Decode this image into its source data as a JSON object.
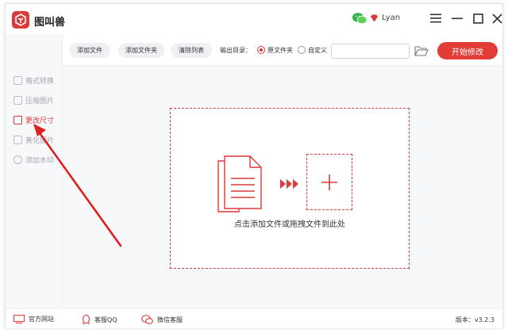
{
  "app": {
    "title": "图叫兽"
  },
  "user": {
    "name": "Lyan"
  },
  "sidebar": {
    "items": [
      {
        "label": "格式转换",
        "active": false
      },
      {
        "label": "压缩图片",
        "active": false
      },
      {
        "label": "更改尺寸",
        "active": true
      },
      {
        "label": "美化图片",
        "active": false
      },
      {
        "label": "添加水印",
        "active": false
      }
    ]
  },
  "toolbar": {
    "add_file": "添加文件",
    "add_folder": "添加文件夹",
    "clear_list": "清除列表",
    "output_label": "输出目录：",
    "option_original": "原文件夹",
    "option_custom": "自定义",
    "path_value": "",
    "start": "开始修改"
  },
  "dropzone": {
    "hint": "点击添加文件或拖拽文件到此处"
  },
  "footer": {
    "website": "官方网站",
    "qq": "客服QQ",
    "wechat": "微信客服",
    "version": "版本：v3.2.3"
  },
  "colors": {
    "accent": "#e23c36",
    "sidebar_bg": "#f7f8fa"
  }
}
